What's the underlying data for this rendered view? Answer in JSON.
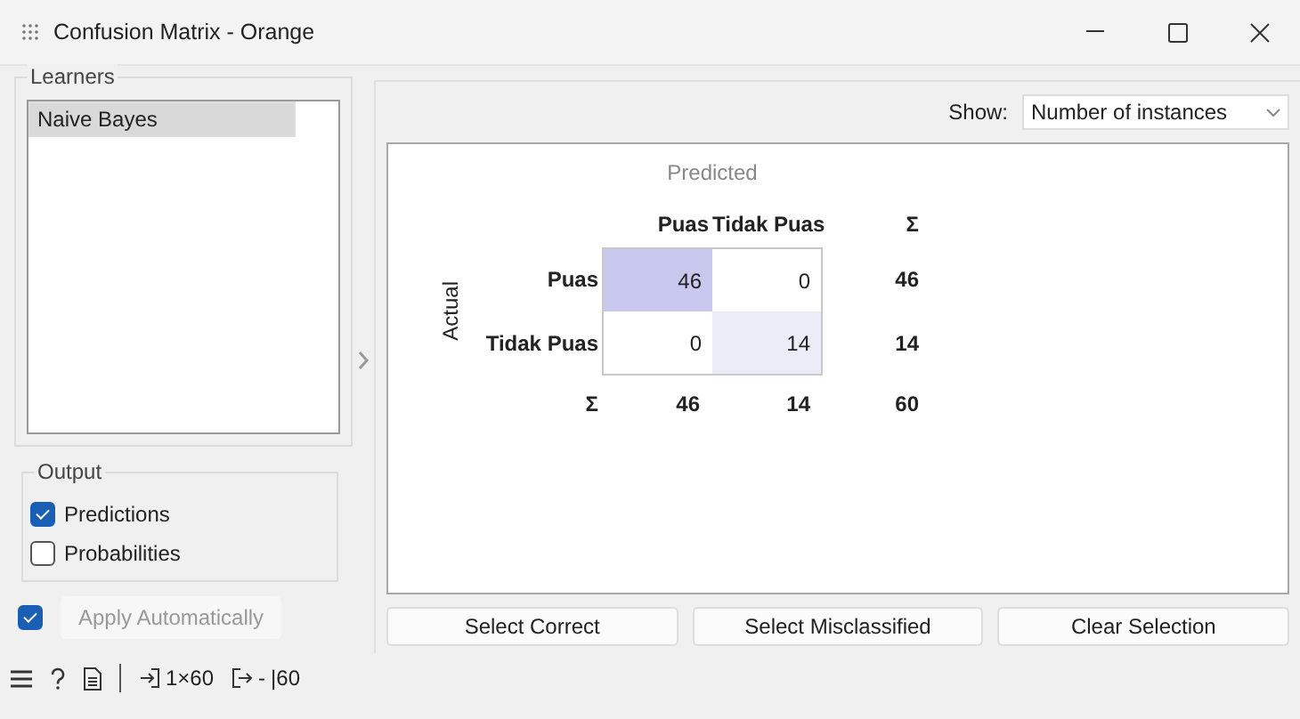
{
  "window": {
    "title": "Confusion Matrix - Orange"
  },
  "learners": {
    "title": "Learners",
    "items": [
      {
        "label": "Naive Bayes",
        "selected": true
      }
    ]
  },
  "output": {
    "title": "Output",
    "options": [
      {
        "label": "Predictions",
        "checked": true
      },
      {
        "label": "Probabilities",
        "checked": false
      }
    ]
  },
  "apply": {
    "label": "Apply Automatically",
    "checked": true,
    "disabled": true
  },
  "show": {
    "label": "Show:",
    "value": "Number of instances"
  },
  "matrix": {
    "predicted_label": "Predicted",
    "actual_label": "Actual",
    "columns": [
      "Puas",
      "Tidak Puas",
      "Σ"
    ],
    "rows": [
      {
        "label": "Puas",
        "cells": [
          {
            "value": "46",
            "color": "#c9c9ef"
          },
          {
            "value": "0",
            "color": "#ffffff"
          }
        ],
        "total": "46"
      },
      {
        "label": "Tidak Puas",
        "cells": [
          {
            "value": "0",
            "color": "#ffffff"
          },
          {
            "value": "14",
            "color": "#ececf8"
          }
        ],
        "total": "14"
      }
    ],
    "totals": {
      "label": "Σ",
      "values": [
        "46",
        "14",
        "60"
      ]
    }
  },
  "buttons": [
    "Select Correct",
    "Select Misclassified",
    "Clear Selection"
  ],
  "status_bar": {
    "input": "1×60",
    "output_dash": "-",
    "output_count": "|60"
  }
}
